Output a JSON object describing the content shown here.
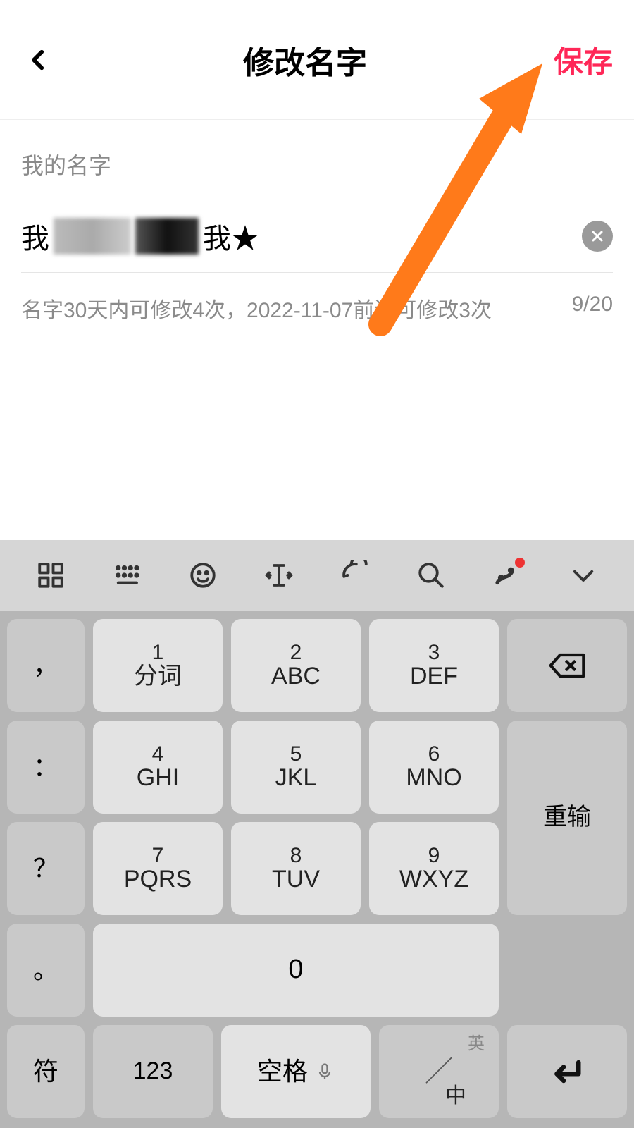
{
  "header": {
    "title": "修改名字",
    "save_label": "保存"
  },
  "form": {
    "field_label": "我的名字",
    "name_prefix": "我",
    "name_suffix": "我★",
    "hint": "名字30天内可修改4次，2022-11-07前还可修改3次",
    "counter": "9/20"
  },
  "keyboard": {
    "keys": {
      "comma": "，",
      "colon": "：",
      "question": "？",
      "circle": "。",
      "k1_num": "1",
      "k1_lab": "分词",
      "k2_num": "2",
      "k2_lab": "ABC",
      "k3_num": "3",
      "k3_lab": "DEF",
      "k4_num": "4",
      "k4_lab": "GHI",
      "k5_num": "5",
      "k5_lab": "JKL",
      "k6_num": "6",
      "k6_lab": "MNO",
      "k7_num": "7",
      "k7_lab": "PQRS",
      "k8_num": "8",
      "k8_lab": "TUV",
      "k9_num": "9",
      "k9_lab": "WXYZ",
      "retype": "重输",
      "zero": "0",
      "symbol": "符",
      "num123": "123",
      "space": "空格",
      "lang_en": "英",
      "lang_zh": "中"
    }
  }
}
